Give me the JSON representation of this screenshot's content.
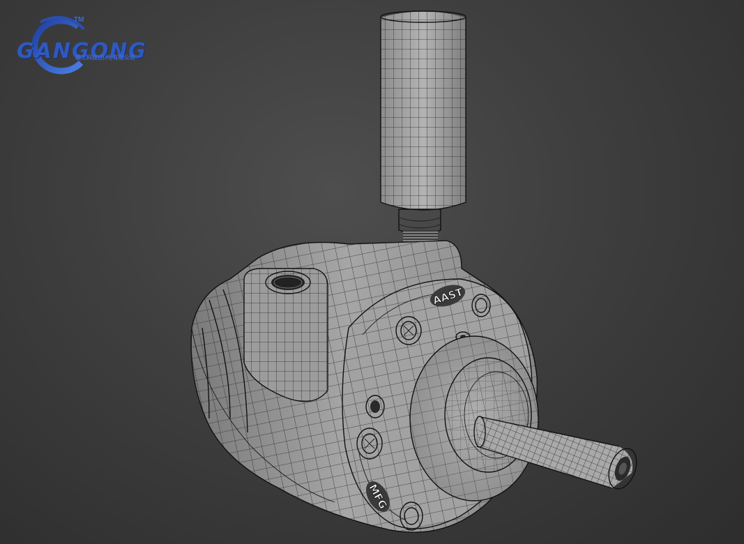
{
  "logo": {
    "name": "GANGONG",
    "tm": "TM",
    "subtitle": "赣工科技(苏州)有限公司"
  },
  "model": {
    "engravings": {
      "top": "AAST",
      "bottom": "MFG"
    }
  },
  "colors": {
    "background": "#3e3e3e",
    "mesh_surface": "#9a9a9a",
    "wire": "#1a1a1a",
    "logo_blue": "#2f59c0"
  }
}
